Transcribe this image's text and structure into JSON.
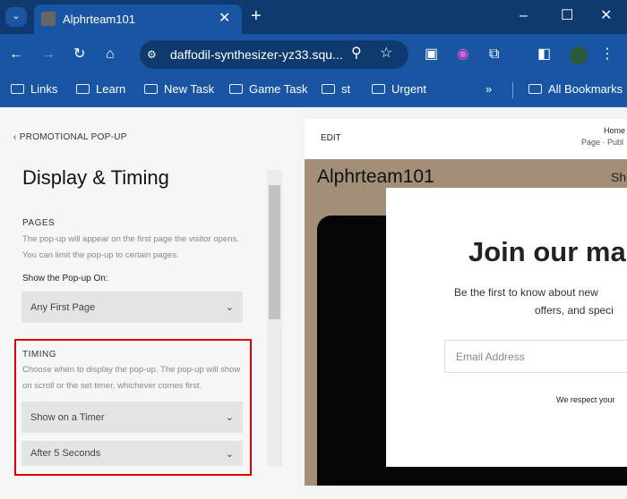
{
  "browser": {
    "tab_title": "Alphrteam101",
    "url": "daffodil-synthesizer-yz33.squ...",
    "bookmarks": [
      "Links",
      "Learn",
      "New Task",
      "Game Task",
      "st",
      "Urgent"
    ],
    "all_bookmarks": "All Bookmarks",
    "overflow": "»"
  },
  "panel": {
    "back_label": "PROMOTIONAL POP-UP",
    "title": "Display & Timing",
    "pages_heading": "PAGES",
    "pages_desc_1": "The pop-up will appear on the first page the visitor opens.",
    "pages_desc_2": "You can limit the pop-up to certain pages.",
    "show_on_label": "Show the Pop-up On:",
    "show_on_value": "Any First Page",
    "timing_heading": "TIMING",
    "timing_desc_1": "Choose when to display the pop-up. The pop-up will show",
    "timing_desc_2": "on scroll or the set timer, whichever comes first.",
    "timing_mode": "Show on a Timer",
    "timing_delay": "After 5 Seconds"
  },
  "preview": {
    "edit_label": "EDIT",
    "page_name": "Home",
    "page_status": "Page · Publ",
    "site_title": "Alphrteam101",
    "nav_item": "Sh",
    "popup_title": "Join our ma",
    "popup_text_1": "Be the first to know about new",
    "popup_text_2": "offers, and speci",
    "email_placeholder": "Email Address",
    "privacy": "We respect your"
  },
  "colors": {
    "highlight": "#e00000",
    "site_bg": "#a38f78",
    "chrome": "#1a55a3"
  }
}
